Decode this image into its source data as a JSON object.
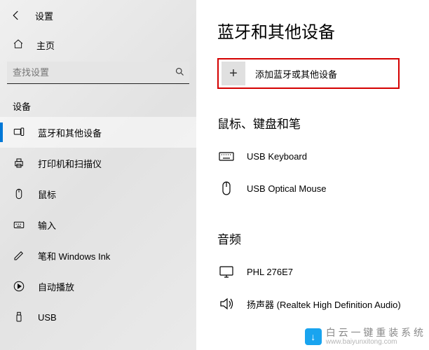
{
  "topbar": {
    "title": "设置"
  },
  "home_label": "主页",
  "search": {
    "placeholder": "查找设置"
  },
  "section_label": "设备",
  "nav": [
    {
      "label": "蓝牙和其他设备",
      "active": true
    },
    {
      "label": "打印机和扫描仪"
    },
    {
      "label": "鼠标"
    },
    {
      "label": "输入"
    },
    {
      "label": "笔和 Windows Ink"
    },
    {
      "label": "自动播放"
    },
    {
      "label": "USB"
    }
  ],
  "page_title": "蓝牙和其他设备",
  "add_device_label": "添加蓝牙或其他设备",
  "group1_title": "鼠标、键盘和笔",
  "group1": [
    {
      "label": "USB Keyboard"
    },
    {
      "label": "USB Optical Mouse"
    }
  ],
  "group2_title": "音频",
  "group2": [
    {
      "label": "PHL 276E7"
    },
    {
      "label": "扬声器 (Realtek High Definition Audio)"
    }
  ],
  "watermark": {
    "brand": "白 云 一 键 重 装 系 统",
    "url": "www.baiyunxitong.com"
  }
}
